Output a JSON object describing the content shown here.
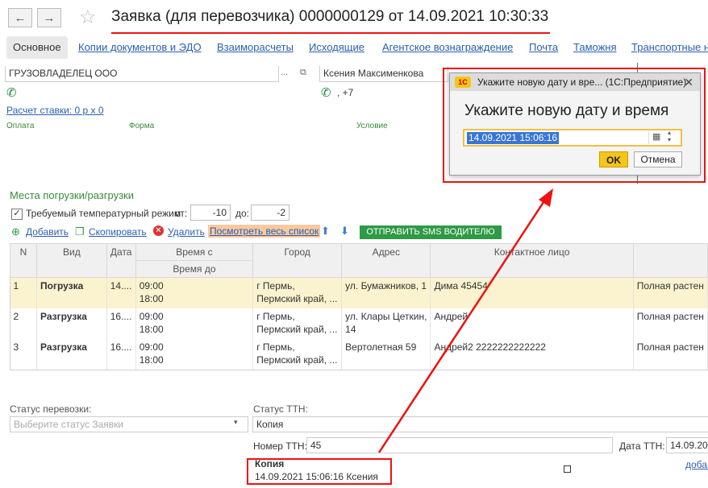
{
  "header": {
    "title": "Заявка (для перевозчика) 0000000129 от 14.09.2021 10:30:33",
    "back_label": "←",
    "forward_label": "→",
    "star": "☆"
  },
  "tabs": [
    {
      "label": "Основное"
    },
    {
      "label": "Копии документов и ЭДО"
    },
    {
      "label": "Взаиморасчеты"
    },
    {
      "label": "Исходящие"
    },
    {
      "label": "Агентское вознаграждение"
    },
    {
      "label": "Почта"
    },
    {
      "label": "Таможня"
    },
    {
      "label": "Транспортные н"
    }
  ],
  "top_fields": {
    "company": "ГРУЗОВЛАДЕЛЕЦ ООО",
    "contact": "Ксения Максименкова",
    "phone": ", +7",
    "rate_link": "Расчет ставки: 0 р х 0",
    "payment_label": "Оплата",
    "form_label": "Форма",
    "condition_label": "Условие"
  },
  "places": {
    "title": "Места погрузки/разгрузки",
    "temp_mode_label": "Требуемый температурный режим",
    "temp_mode_checked": "✓",
    "from_label": "от:",
    "from_value": "-10",
    "to_label": "до:",
    "to_value": "-2"
  },
  "commands": {
    "add": "Добавить",
    "copy": "Скопировать",
    "delete": "Удалить",
    "view_all": "Посмотреть весь список",
    "sms": "ОТПРАВИТЬ SMS ВОДИТЕЛЮ"
  },
  "grid": {
    "columns": [
      "N",
      "Вид",
      "Дата",
      "Время с",
      "Время до",
      "Город",
      "Адрес",
      "Контактное лицо",
      ""
    ],
    "rows": [
      {
        "n": "1",
        "kind": "Погрузка",
        "date": "14....",
        "time_from": "09:00",
        "time_to": "18:00",
        "city1": "г Пермь,",
        "city2": "Пермский край, ...",
        "addr1": "ул. Бумажников, 1",
        "addr2": "",
        "contact": "Дима 45454",
        "extra": "Полная растен"
      },
      {
        "n": "2",
        "kind": "Разгрузка",
        "date": "16....",
        "time_from": "09:00",
        "time_to": "18:00",
        "city1": "г Пермь,",
        "city2": "Пермский край, ...",
        "addr1": "ул. Клары Цеткин,",
        "addr2": "14",
        "contact": "Андрей",
        "extra": "Полная растен"
      },
      {
        "n": "3",
        "kind": "Разгрузка",
        "date": "16....",
        "time_from": "09:00",
        "time_to": "18:00",
        "city1": "г Пермь,",
        "city2": "Пермский край, ...",
        "addr1": "Вертолетная 59",
        "addr2": "",
        "contact": "Андрей2 2222222222222",
        "extra": "Полная растен"
      }
    ]
  },
  "bottom": {
    "transport_status_label": "Статус перевозки:",
    "transport_status_placeholder": "Выберите статус Заявки",
    "ttn_status_label": "Статус ТТН:",
    "ttn_status_value": "Копия",
    "ttn_number_label": "Номер ТТН:",
    "ttn_number_value": "45",
    "ttn_date_label": "Дата ТТН:",
    "ttn_date_value": "14.09.202",
    "history_title": "Копия",
    "history_line": "14.09.2021 15:06:16 Ксения",
    "add_link": "добав"
  },
  "dialog": {
    "window_title": "Укажите новую дату и вре... (1С:Предприятие)",
    "logo": "1С",
    "heading": "Укажите новую дату и время",
    "value": "14.09.2021 15:06:16",
    "ok_label": "OK",
    "cancel_label": "Отмена"
  },
  "colors": {
    "annotation": "#e11111",
    "accent": "#f5c518",
    "selected_row": "#fbf3cf"
  }
}
